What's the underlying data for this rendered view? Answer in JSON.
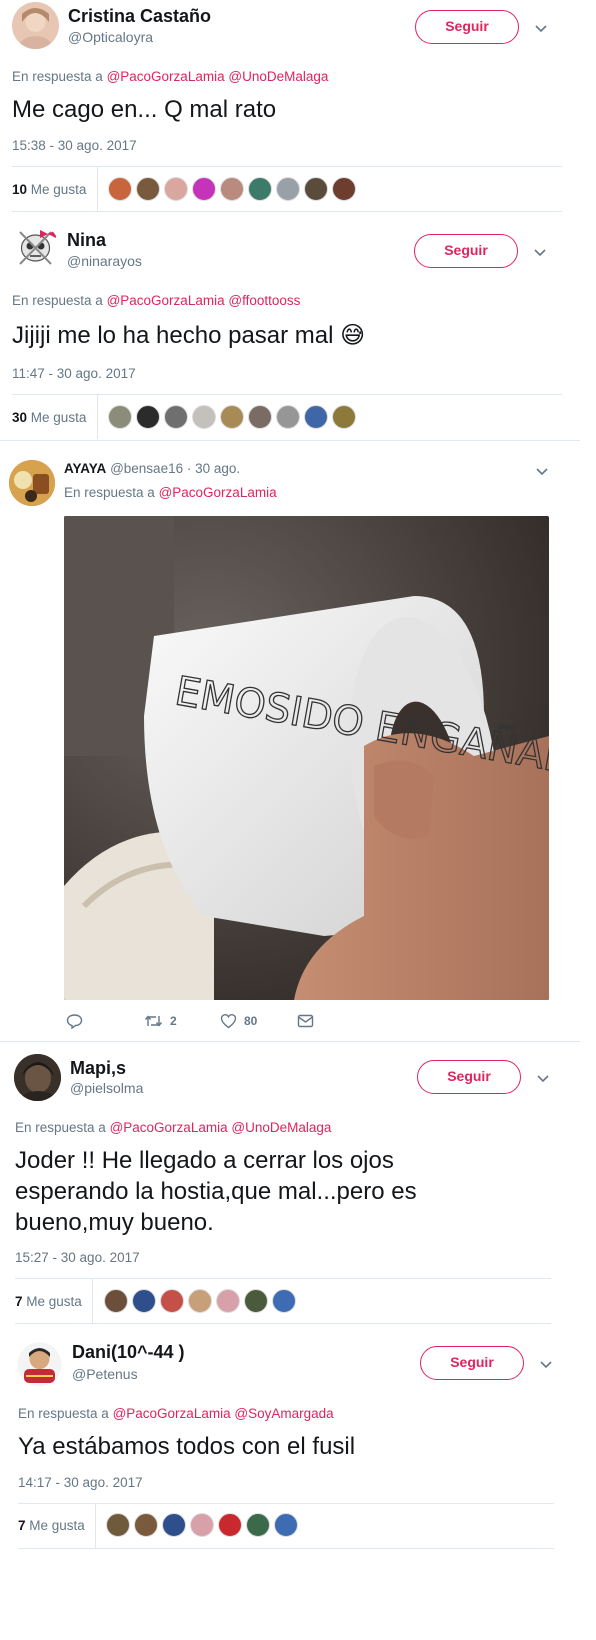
{
  "colors": {
    "accent": "#e0245e",
    "muted": "#657786",
    "text": "#14171a",
    "divider": "#e1e8ed"
  },
  "follow_label": "Seguir",
  "reply_prefix": "En respuesta a",
  "likes_label": "Me gusta",
  "tweets": [
    {
      "name": "Cristina Castaño",
      "handle": "@Opticaloyra",
      "mentions": [
        "@PacoGorzaLamia",
        "@UnoDeMalaga"
      ],
      "text": "Me cago en...  Q mal rato",
      "time": "15:38 - 30 ago. 2017",
      "likes": "10",
      "avatar_color": "#e8c6b4",
      "liker_colors": [
        "#c9653c",
        "#7a5a3c",
        "#d9a7a0",
        "#c534b8",
        "#b98a7e",
        "#3c7b6a",
        "#9aa0a8",
        "#5b4b3a",
        "#6d3d30"
      ]
    },
    {
      "name": "Nina",
      "handle": "@ninarayos",
      "mentions": [
        "@PacoGorzaLamia",
        "@ffoottooss"
      ],
      "text": "Jijiji me lo ha hecho pasar mal",
      "emoji": "😅",
      "time": "11:47 - 30 ago. 2017",
      "likes": "30",
      "avatar_color": "#e9e9e9",
      "liker_colors": [
        "#8c8c7a",
        "#2b2b2b",
        "#6f6f6f",
        "#c4c0bb",
        "#a88a56",
        "#7a6b65",
        "#969696",
        "#3f67a8",
        "#8d7a3a"
      ]
    },
    {
      "name": "AYAYA",
      "handle": "@bensae16",
      "date": "· 30 ago.",
      "mentions": [
        "@PacoGorzaLamia"
      ],
      "photo_text": "EMOSIDO ENGAÑADO",
      "replies": "",
      "retweets": "2",
      "likes": "80",
      "avatar_color": "#c78b3f"
    },
    {
      "name": "Mapi,s",
      "handle": "@pielsolma",
      "mentions": [
        "@PacoGorzaLamia",
        "@UnoDeMalaga"
      ],
      "text": "Joder !! He llegado a cerrar los ojos esperando la hostia,que mal...pero es bueno,muy bueno.",
      "time": "15:27 - 30 ago. 2017",
      "likes": "7",
      "avatar_color": "#5a4a3e",
      "liker_colors": [
        "#6b4f3a",
        "#2e4e8c",
        "#c45048",
        "#c7a07a",
        "#d8a0a8",
        "#4b5a3c",
        "#3d6cb3"
      ]
    },
    {
      "name": "Dani(10^-44 )",
      "handle": "@Petenus",
      "mentions": [
        "@PacoGorzaLamia",
        "@SoyAmargada"
      ],
      "text": "Ya estábamos todos con el fusil",
      "time": "14:17 - 30 ago. 2017",
      "likes": "7",
      "avatar_color": "#c32a3a",
      "liker_colors": [
        "#6f5a3c",
        "#7a5a3c",
        "#2e4e8c",
        "#d8a0a8",
        "#c8282e",
        "#3a6a4a",
        "#3d6cb3"
      ]
    }
  ]
}
